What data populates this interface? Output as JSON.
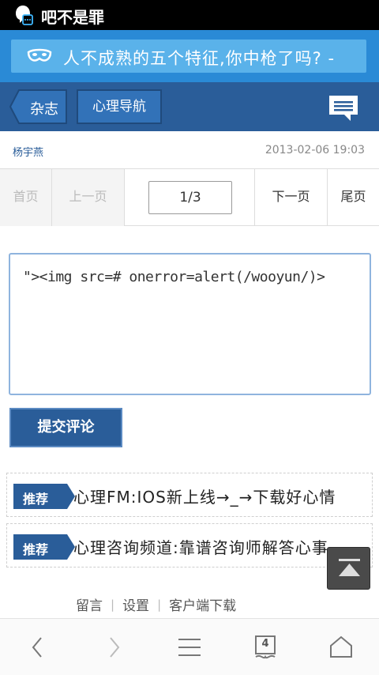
{
  "status_bar": {
    "app_title": "吧不是罪"
  },
  "banner": {
    "text": "人不成熟的五个特征,你中枪了吗? -"
  },
  "navbar": {
    "back_label": "杂志",
    "nav_label": "心理导航"
  },
  "article_meta": {
    "author": "杨宇燕",
    "date": "2013-02-06 19:03"
  },
  "pager": {
    "first": "首页",
    "prev": "上一页",
    "page": "1/3",
    "next": "下一页",
    "last": "尾页"
  },
  "comment": {
    "value": "\"><img src=# onerror=alert(/wooyun/)>"
  },
  "submit_label": "提交评论",
  "recommend": [
    {
      "tag": "推荐",
      "text": "心理FM:IOS新上线→_→下载好心情"
    },
    {
      "tag": "推荐",
      "text": "心理咨询频道:靠谱咨询师解答心事"
    }
  ],
  "footer_links": [
    "留言",
    "设置",
    "客户端下载"
  ],
  "bottom_bar": {
    "tabs_count": "4",
    "icons": [
      "back-icon",
      "forward-icon",
      "menu-icon",
      "tabs-icon",
      "home-icon"
    ]
  },
  "colors": {
    "banner_bg": "#2a8ad6",
    "navbar_bg": "#2a5d99",
    "accent": "#2a5d99"
  }
}
